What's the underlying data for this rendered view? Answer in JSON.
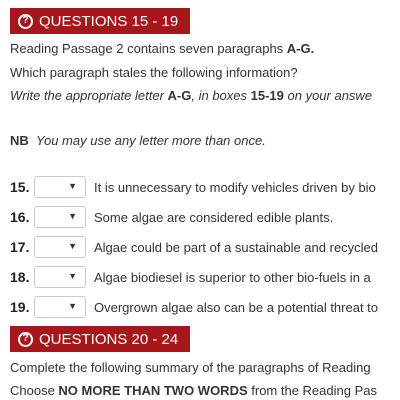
{
  "section1": {
    "title": "QUESTIONS 15 - 19",
    "intro_pre": "Reading Passage 2 contains seven paragraphs ",
    "intro_bold": "A-G.",
    "line2": "Which paragraph stales the following information?",
    "instr_pre": "Write the appropriate letter ",
    "instr_bold1": "A-G",
    "instr_mid": ", in boxes ",
    "instr_bold2": "15-19",
    "instr_post": " on your answe",
    "nb_label": "NB",
    "nb_text": "You may use any letter more than once."
  },
  "questions": [
    {
      "num": "15.",
      "selected": "",
      "text": "It is unnecessary to modify vehicles driven by bio"
    },
    {
      "num": "16.",
      "selected": "",
      "text": "Some algae are considered edible plants."
    },
    {
      "num": "17.",
      "selected": "",
      "text": "Algae could be part of a sustainable and recycled"
    },
    {
      "num": "18.",
      "selected": "",
      "text": "Algae biodiesel is superior to other bio-fuels in a"
    },
    {
      "num": "19.",
      "selected": "",
      "text": "Overgrown algae also can be a potential threat to"
    }
  ],
  "section2": {
    "title": "QUESTIONS 20 - 24",
    "line1": "Complete the following summary of the paragraphs of Reading",
    "line2_pre": "Choose ",
    "line2_bold": "NO MORE THAN TWO WORDS",
    "line2_post": " from the Reading Pas"
  },
  "icons": {
    "question": "question-circle-icon",
    "dropdown": "chevron-down-icon"
  },
  "colors": {
    "banner": "#a6171c",
    "text": "#333333"
  }
}
